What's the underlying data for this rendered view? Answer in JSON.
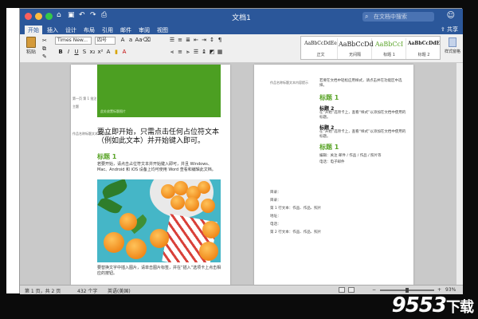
{
  "window": {
    "title": "文档1"
  },
  "search": {
    "placeholder": "在文档中搜索"
  },
  "share": "共享",
  "tabs": [
    "开始",
    "插入",
    "设计",
    "布局",
    "引用",
    "邮件",
    "审阅",
    "视图"
  ],
  "ribbon": {
    "paste_label": "粘贴",
    "font_name": "Times New...",
    "font_size": "四号",
    "styles": [
      {
        "preview": "AaBbCcDdEe",
        "name": "正文"
      },
      {
        "preview": "AaBbCcDd",
        "name": "无间隔"
      },
      {
        "preview": "AaBbCcI",
        "name": "标题 1"
      },
      {
        "preview": "AaBbCcDdE",
        "name": "标题 2"
      }
    ],
    "styles_pane_label": "样式窗格"
  },
  "page1": {
    "green_caption": "此处放置标题图片",
    "left_comment_1": "第一页 第 1 批注",
    "left_comment_2": "主题",
    "left_comment_3": "作品名称标题文本内容提示",
    "heading": "要立即开始，只需点击任何占位符文本（例如此文本）并开始键入即可。",
    "section_title": "标题 1",
    "intro": "若要开始，请点击占位符文本并开始键入即可，并且 Windows、Mac、Android 和 iOS 设备上均可使用 Word 查看和编辑此文档。",
    "photo_caption": "要替换文字中插入图片，请单击图片标签，并在“插入”选项卡上点击相应的按钮。"
  },
  "page2": {
    "comment": "作品名称标题文本内容提示",
    "intro": "若要在文档中轻松应用样式，请点击并在功能区中选择。",
    "title1": "标题 1",
    "h2a": "标题 2",
    "p2a": "在“开始”选项卡上，查看“样式”以添加在文档中使用的标题。",
    "h2b": "标题 2",
    "p2b": "在“开始”选项卡上，查看“样式”以添加在文档中使用的标题。",
    "title1b": "标题 1",
    "p3": "编辑：关注 邮件 / 作品 / 作品 / 照片等",
    "p4": "电话：电子邮件",
    "foot1": "目录：",
    "foot2": "目录：",
    "foot3": "第 1 行文本：作品、作品、照片",
    "foot4": "地址：",
    "foot5": "电话：",
    "foot6": "第 2 行文本：作品、作品、照片"
  },
  "status": {
    "page": "第 1 页，共 2 页",
    "words": "432 个字",
    "lang": "英语(美国)",
    "zoom": "93%"
  },
  "watermark": {
    "num": "9553",
    "suffix": "下载"
  }
}
